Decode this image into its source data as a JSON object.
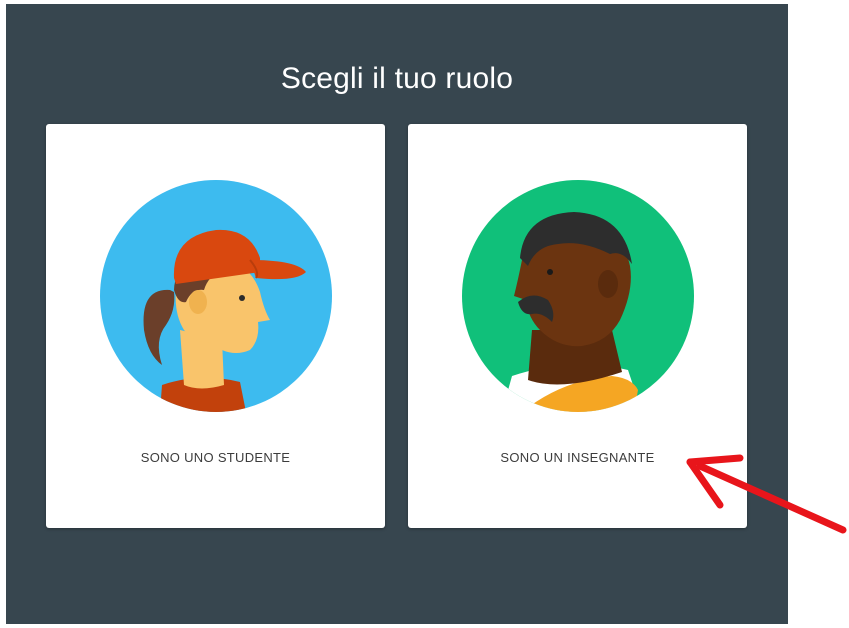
{
  "page": {
    "title": "Scegli il tuo ruolo"
  },
  "roles": [
    {
      "label": "SONO UNO STUDENTE",
      "circle_color": "#3dbbef"
    },
    {
      "label": "SONO UN INSEGNANTE",
      "circle_color": "#10c07a"
    }
  ],
  "colors": {
    "background": "#37464f",
    "card": "#ffffff",
    "annotation_arrow": "#e8151b"
  },
  "annotation": {
    "icon": "red-arrow-icon",
    "points_to": "SONO UN INSEGNANTE"
  }
}
